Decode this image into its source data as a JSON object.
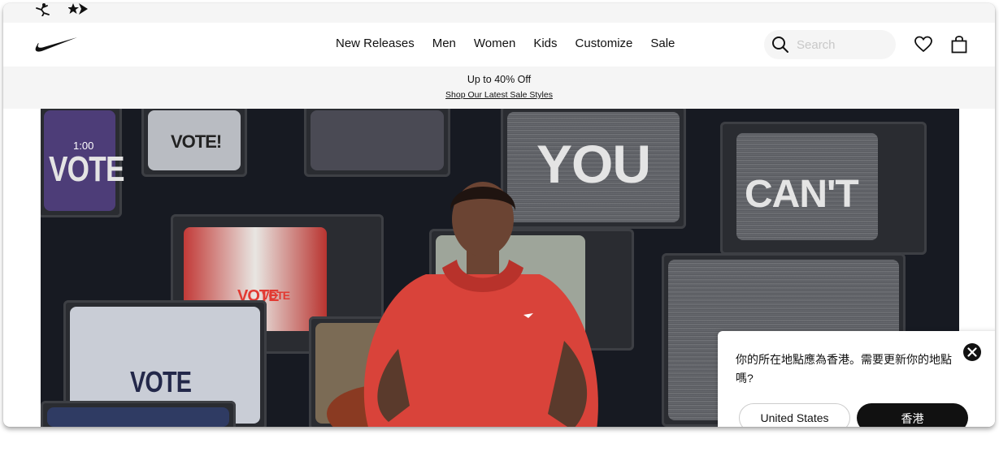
{
  "brand_strip": {
    "icons": [
      "jordan-jumpman-icon",
      "converse-star-chevron-icon"
    ]
  },
  "nav": {
    "logo": "nike-swoosh-icon",
    "menu": [
      "New Releases",
      "Men",
      "Women",
      "Kids",
      "Customize",
      "Sale"
    ],
    "search": {
      "placeholder": "Search",
      "icon": "search-icon"
    },
    "actions": [
      "heart-icon",
      "bag-icon"
    ]
  },
  "promo": {
    "title": "Up to 40% Off",
    "link": "Shop Our Latest Sale Styles"
  },
  "hero": {
    "video_time": "1:00",
    "tv_texts": [
      "VOTE",
      "VOTE!",
      "YOU",
      "CAN'T",
      "VOTE",
      "VOTE",
      "VOTE"
    ]
  },
  "location_dialog": {
    "message": "你的所在地點應為香港。需要更新你的地點嗎?",
    "secondary_button": "United States",
    "primary_button": "香港"
  },
  "colors": {
    "text": "#111111",
    "background": "#ffffff",
    "subtle_bg": "#f5f5f5",
    "hero_dark": "#171a22",
    "hoodie_red": "#d9433a"
  }
}
